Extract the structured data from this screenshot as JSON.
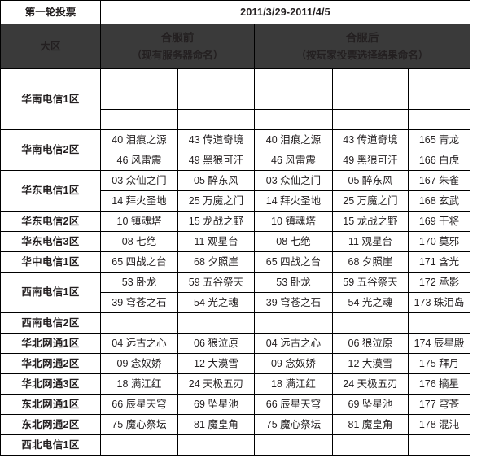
{
  "title": {
    "label": "第一轮投票",
    "value": "2011/3/29-2011/4/5"
  },
  "header": {
    "region_col": "大区",
    "before_main": "合服前",
    "before_sub": "（现有服务器命名）",
    "after_main": "合服后",
    "after_sub": "（按玩家投票选择结果命名）"
  },
  "colors": {
    "header_bg": "#3a3a3a",
    "header_text": "#ffffff",
    "border": "#000000",
    "body_text": "#231f20"
  },
  "rows": [
    {
      "region": "华南电信1区",
      "cells": [
        [
          "",
          "",
          "",
          "",
          ""
        ],
        [
          "",
          "",
          "",
          "",
          ""
        ],
        [
          "",
          "",
          "",
          "",
          ""
        ]
      ]
    },
    {
      "region": "华南电信2区",
      "cells": [
        [
          "40 泪痕之源",
          "43 传道奇境",
          "40 泪痕之源",
          "43 传道奇境",
          "165 青龙"
        ],
        [
          "46 风雷震",
          "49 黑狼可汗",
          "46 风雷震",
          "49 黑狼可汗",
          "166 白虎"
        ]
      ]
    },
    {
      "region": "华东电信1区",
      "cells": [
        [
          "03 众仙之门",
          "05 醉东风",
          "03 众仙之门",
          "05 醉东风",
          "167 朱雀"
        ],
        [
          "14 拜火圣地",
          "25 万魔之门",
          "14 拜火圣地",
          "25 万魔之门",
          "168 玄武"
        ]
      ]
    },
    {
      "region": "华东电信2区",
      "cells": [
        [
          "10 镇魂塔",
          "15 龙战之野",
          "10 镇魂塔",
          "15 龙战之野",
          "169 干将"
        ]
      ]
    },
    {
      "region": "华东电信3区",
      "cells": [
        [
          "08 七绝",
          "11 观星台",
          "08 七绝",
          "11 观星台",
          "170 莫邪"
        ]
      ]
    },
    {
      "region": "华中电信1区",
      "cells": [
        [
          "65 四战之台",
          "68 夕照崖",
          "65 四战之台",
          "68 夕照崖",
          "171 含光"
        ]
      ]
    },
    {
      "region": "西南电信1区",
      "cells": [
        [
          "53 卧龙",
          "59 五谷祭天",
          "53 卧龙",
          "59 五谷祭天",
          "172 承影"
        ],
        [
          "39 穹苍之石",
          "54 光之魂",
          "39 穹苍之石",
          "54 光之魂",
          "173 珠泪岛"
        ]
      ]
    },
    {
      "region": "西南电信2区",
      "cells": [
        [
          "",
          "",
          "",
          "",
          ""
        ]
      ]
    },
    {
      "region": "华北网通1区",
      "cells": [
        [
          "04 远古之心",
          "06 狼泣原",
          "04 远古之心",
          "06 狼泣原",
          "174 辰星殿"
        ]
      ]
    },
    {
      "region": "华北网通2区",
      "cells": [
        [
          "09 念奴娇",
          "12 大漠雪",
          "09 念奴娇",
          "12 大漠雪",
          "175 拜月"
        ]
      ]
    },
    {
      "region": "华北网通3区",
      "cells": [
        [
          "18 满江红",
          "24 天极五刃",
          "18 满江红",
          "24 天极五刃",
          "176 摘星"
        ]
      ]
    },
    {
      "region": "东北网通1区",
      "cells": [
        [
          "66 辰星天穹",
          "69 坠星池",
          "66 辰星天穹",
          "69 坠星池",
          "177 穹苍"
        ]
      ]
    },
    {
      "region": "东北网通2区",
      "cells": [
        [
          "75 魔心祭坛",
          "81 魔皇角",
          "75 魔心祭坛",
          "81 魔皇角",
          "178 混沌"
        ]
      ]
    },
    {
      "region": "西北电信1区",
      "cells": [
        [
          "",
          "",
          "",
          "",
          ""
        ]
      ]
    }
  ]
}
